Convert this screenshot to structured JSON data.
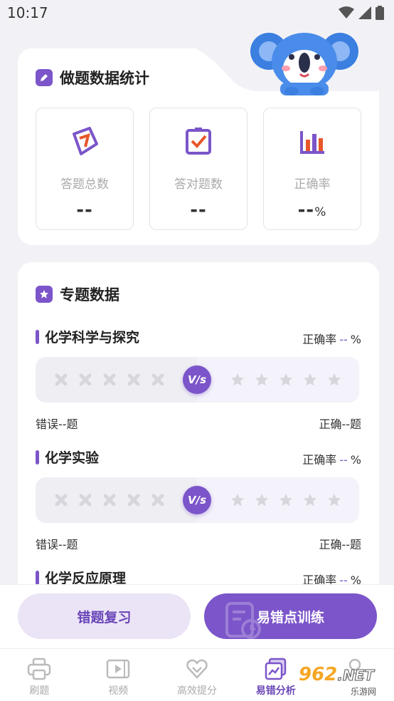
{
  "status_bar": {
    "time": "10:17"
  },
  "stats": {
    "title": "做题数据统计",
    "items": [
      {
        "label": "答题总数",
        "value": "--",
        "unit": ""
      },
      {
        "label": "答对题数",
        "value": "--",
        "unit": ""
      },
      {
        "label": "正确率",
        "value": "--",
        "unit": "%"
      }
    ]
  },
  "topics": {
    "title": "专题数据",
    "rate_label": "正确率",
    "rate_value": "--",
    "rate_unit": "%",
    "vs_label": "V/s",
    "items": [
      {
        "name": "化学科学与探究",
        "wrong": "错误--题",
        "right": "正确--题"
      },
      {
        "name": "化学实验",
        "wrong": "错误--题",
        "right": "正确--题"
      },
      {
        "name": "化学反应原理"
      }
    ]
  },
  "actions": {
    "review": "错题复习",
    "train": "易错点训练"
  },
  "tabs": [
    {
      "label": "刷题",
      "icon": "printer-icon",
      "active": false
    },
    {
      "label": "视频",
      "icon": "video-icon",
      "active": false
    },
    {
      "label": "高效提分",
      "icon": "heart-icon",
      "active": false
    },
    {
      "label": "易错分析",
      "icon": "chart-icon",
      "active": true
    },
    {
      "label": "",
      "icon": "user-icon",
      "active": false
    }
  ],
  "watermark": {
    "brand": "962",
    "suffix": ".NET",
    "sub": "乐游网"
  },
  "colors": {
    "accent": "#7b55c9",
    "accent_light": "#ebe4f6",
    "orange": "#e8572a"
  }
}
